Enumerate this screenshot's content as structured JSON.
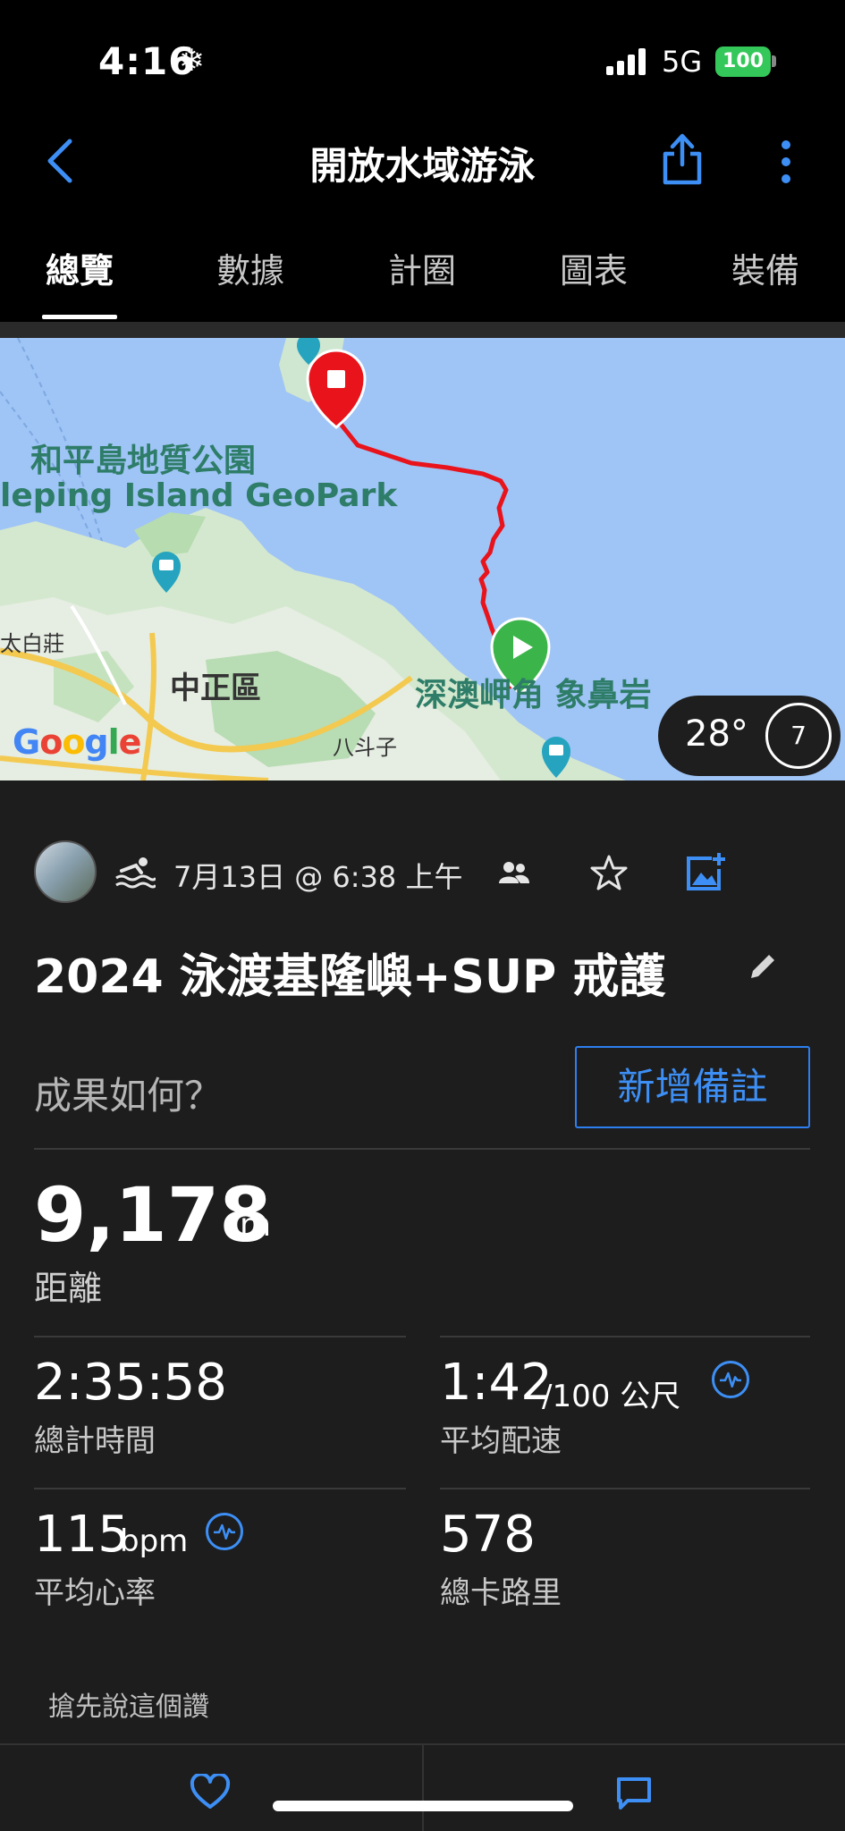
{
  "status_bar": {
    "time": "4:16",
    "network": "5G",
    "battery": "100"
  },
  "header": {
    "title": "開放水域游泳"
  },
  "tabs": [
    {
      "label": "總覽",
      "active": true
    },
    {
      "label": "數據",
      "active": false
    },
    {
      "label": "計圈",
      "active": false
    },
    {
      "label": "圖表",
      "active": false
    },
    {
      "label": "裝備",
      "active": false
    }
  ],
  "map": {
    "labels": {
      "geopark_zh": "和平島地質公園",
      "geopark_en": "leping Island GeoPark",
      "taibai": "太白莊",
      "zhongzheng": "中正區",
      "shenao": "深澳岬角 象鼻岩",
      "badouzi": "八斗子"
    },
    "weather": {
      "temp": "28°",
      "wind": "7"
    },
    "attribution": "Google",
    "route_color": "#e8131b"
  },
  "activity": {
    "date": "7月13日 @ 6:38 上午",
    "title": "2024 泳渡基隆嶼+SUP 戒護",
    "prompt": "成果如何？",
    "add_note": "新增備註"
  },
  "stats": {
    "distance": {
      "value": "9,178",
      "unit": "m",
      "label": "距離"
    },
    "total_time": {
      "value": "2:35:58",
      "label": "總計時間"
    },
    "avg_pace": {
      "value": "1:42",
      "unit": "/100 公尺",
      "label": "平均配速"
    },
    "avg_hr": {
      "value": "115",
      "unit": "bpm",
      "label": "平均心率"
    },
    "calories": {
      "value": "578",
      "label": "總卡路里"
    }
  },
  "social": {
    "kudos_prompt": "搶先說這個讚"
  },
  "colors": {
    "accent": "#3d8ff5",
    "background": "#1d1d1d",
    "battery": "#34c759"
  }
}
